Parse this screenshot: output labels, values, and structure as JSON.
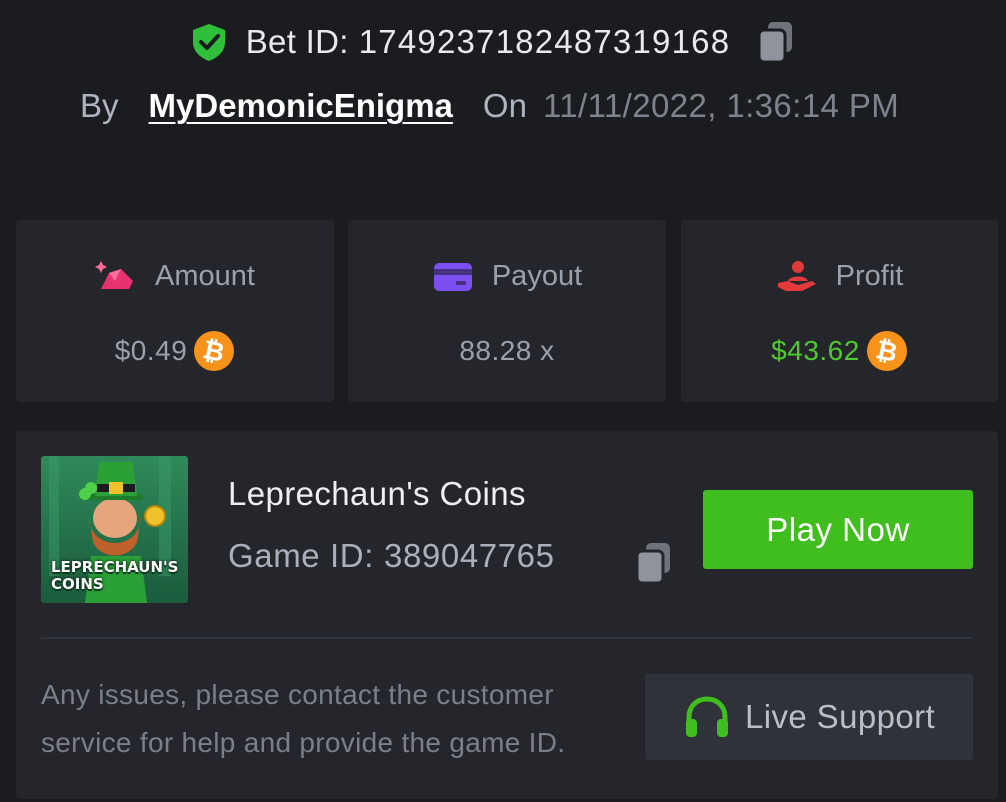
{
  "bet": {
    "label": "Bet ID:",
    "id": "174923718248731916​8"
  },
  "meta": {
    "by_label": "By",
    "username": "MyDemonicEnigma",
    "on_label": "On",
    "timestamp": "11/11/2022, 1:36:14 PM"
  },
  "stats": [
    {
      "label": "Amount",
      "value": "$0.49",
      "icon": "money-bag-icon",
      "currency_icon": "bitcoin-icon"
    },
    {
      "label": "Payout",
      "value": "88.28 x",
      "icon": "credit-card-icon"
    },
    {
      "label": "Profit",
      "value": "$43.62",
      "icon": "profit-hand-icon",
      "currency_icon": "bitcoin-icon"
    }
  ],
  "game": {
    "name": "Leprechaun's Coins",
    "id_label": "Game ID:",
    "id": "389047765",
    "thumbnail_title": "LEPRECHAUN'S COINS",
    "play_label": "Play Now"
  },
  "support": {
    "notice": "Any issues, please contact the customer service for help and provide the game ID.",
    "button_label": "Live Support"
  },
  "colors": {
    "background": "#1b1c20",
    "card": "#24262b",
    "accent_green": "#3fbe1e",
    "profit_green": "#4ec930",
    "shield_green": "#2fbf3a",
    "amount_pink": "#e8326f",
    "payout_purple": "#7b4ff2",
    "profit_red": "#e23a3a",
    "bitcoin_orange": "#f7931a"
  }
}
